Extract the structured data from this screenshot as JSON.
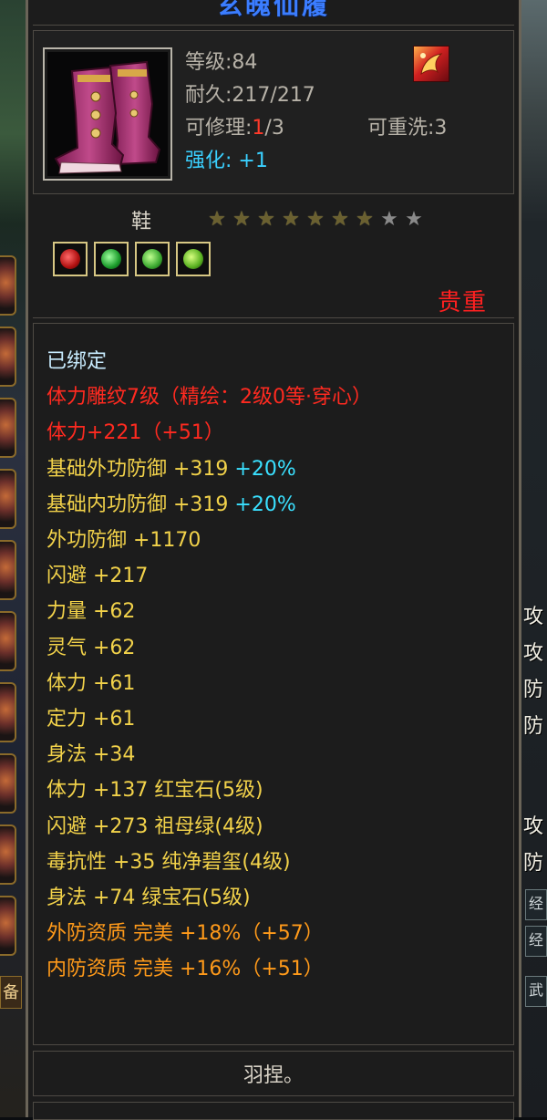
{
  "item": {
    "name": "玄魄仙履",
    "level_line": "等级:84",
    "durability_line": "耐久:217/217",
    "repair_label": "可修理:",
    "repair_current": "1",
    "repair_max": "/3",
    "rewash_line": "可重洗:3",
    "enhance_label": "强化:",
    "enhance_value": "+1",
    "slot_type": "鞋",
    "stars_total": 9,
    "stars_lit": 7,
    "rarity": "贵重",
    "description": "羽捏。"
  },
  "icons": {
    "item_icon": "boots-icon",
    "quality_icon": "phoenix-quality-icon",
    "gems": [
      "ruby-gem-icon",
      "emerald-gem-icon",
      "jade-gem-icon",
      "green-gem-icon"
    ]
  },
  "attributes": [
    {
      "text": "已绑定",
      "color": "white"
    },
    {
      "text": "体力雕纹7级（精绘：2级0等·穿心）",
      "color": "red"
    },
    {
      "text": "体力+221（+51）",
      "color": "red"
    },
    {
      "text": "基础外功防御 +319 ",
      "suffix": "+20%",
      "color": "yellow"
    },
    {
      "text": "基础内功防御 +319 ",
      "suffix": "+20%",
      "color": "yellow"
    },
    {
      "text": "外功防御 +1170",
      "color": "yellow"
    },
    {
      "text": "闪避 +217",
      "color": "yellow"
    },
    {
      "text": "力量 +62",
      "color": "yellow"
    },
    {
      "text": "灵气 +62",
      "color": "yellow"
    },
    {
      "text": "体力 +61",
      "color": "yellow"
    },
    {
      "text": "定力 +61",
      "color": "yellow"
    },
    {
      "text": "身法 +34",
      "color": "yellow"
    },
    {
      "text": "体力 +137 红宝石(5级)",
      "color": "yellow"
    },
    {
      "text": "闪避 +273 祖母绿(4级)",
      "color": "yellow"
    },
    {
      "text": "毒抗性 +35 纯净碧玺(4级)",
      "color": "yellow"
    },
    {
      "text": "身法 +74 绿宝石(5级)",
      "color": "yellow"
    },
    {
      "text": "外防资质   完美 +18%（+57）",
      "color": "orange"
    },
    {
      "text": "内防资质   完美 +16%（+51）",
      "color": "orange"
    }
  ],
  "right_strip": {
    "chars": [
      "攻",
      "攻",
      "防",
      "防",
      "攻",
      "防"
    ],
    "boxes": [
      "经",
      "经",
      "武"
    ]
  },
  "left_strip": {
    "tag": "备"
  },
  "colors": {
    "name": "#3b7dff",
    "rarity": "#ff2020",
    "bound": "#c8ecff",
    "carving": "#ff2a20",
    "stat": "#f2d24a",
    "aptitude": "#ff9a1a",
    "percent_bonus": "#3ae0ff"
  }
}
